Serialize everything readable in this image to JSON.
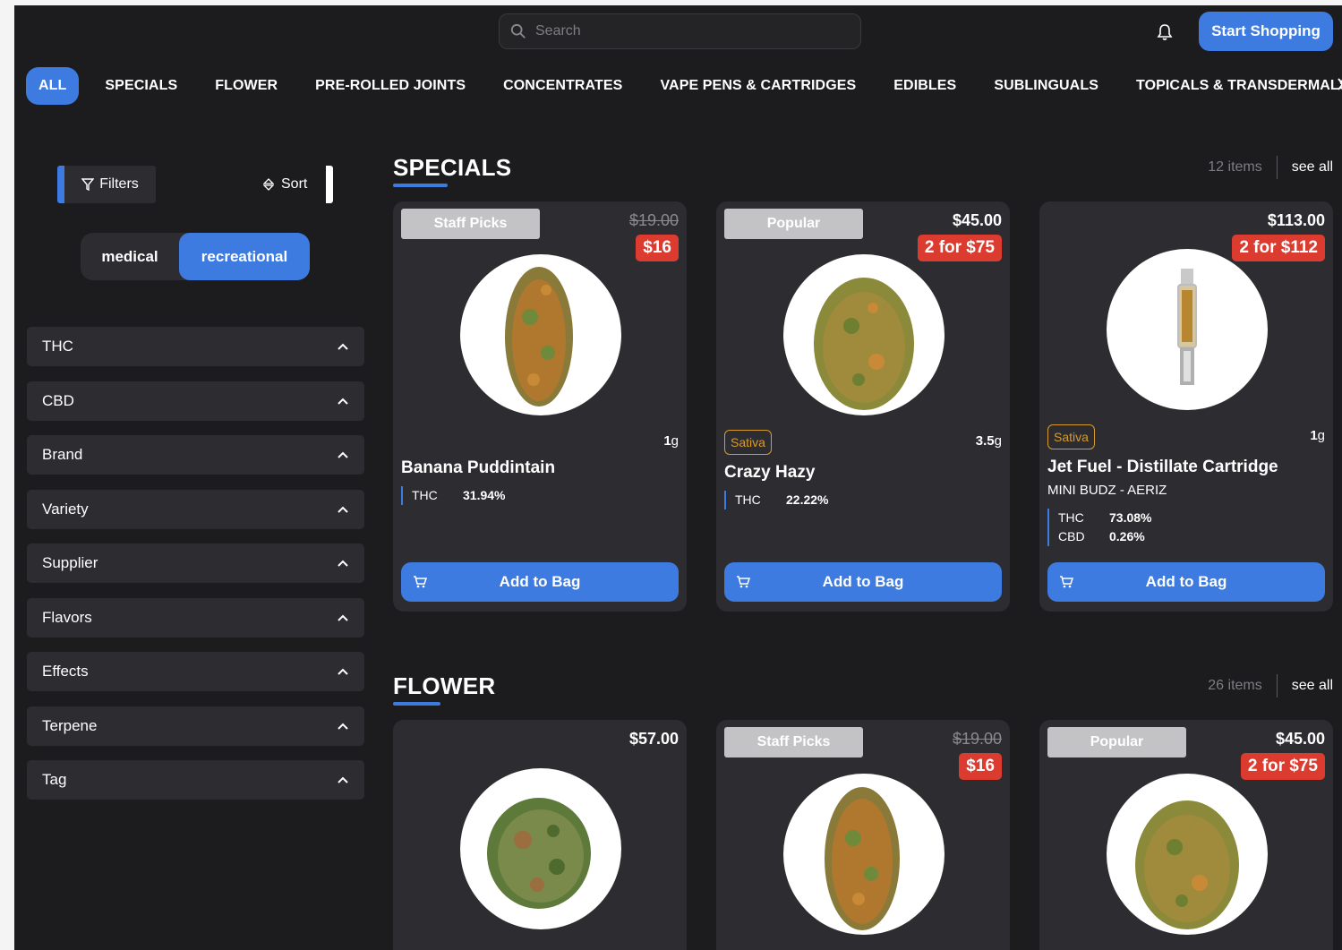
{
  "header": {
    "search_placeholder": "Search",
    "start_shopping_label": "Start Shopping"
  },
  "nav": {
    "items": [
      {
        "label": "ALL",
        "active": true
      },
      {
        "label": "SPECIALS"
      },
      {
        "label": "FLOWER"
      },
      {
        "label": "PRE-ROLLED JOINTS"
      },
      {
        "label": "CONCENTRATES"
      },
      {
        "label": "VAPE PENS & CARTRIDGES"
      },
      {
        "label": "EDIBLES"
      },
      {
        "label": "SUBLINGUALS"
      },
      {
        "label": "TOPICALS & TRANSDERMALS"
      }
    ]
  },
  "sidebar": {
    "filters_label": "Filters",
    "sort_label": "Sort",
    "toggle": {
      "medical": "medical",
      "recreational": "recreational",
      "selected": "recreational"
    },
    "accordion": [
      "THC",
      "CBD",
      "Brand",
      "Variety",
      "Supplier",
      "Flavors",
      "Effects",
      "Terpene",
      "Tag"
    ]
  },
  "sections": {
    "specials": {
      "title": "SPECIALS",
      "count": "12 items",
      "see_all": "see all",
      "cards": [
        {
          "badge": "Staff Picks",
          "price": "$19.00",
          "deal": "$16",
          "weight_num": "1",
          "weight_unit": "g",
          "name": "Banana Puddintain",
          "thc_label": "THC",
          "thc": "31.94%"
        },
        {
          "badge": "Popular",
          "price": "$45.00",
          "deal": "2 for $75",
          "strain": "Sativa",
          "weight_num": "3.5",
          "weight_unit": "g",
          "name": "Crazy Hazy",
          "thc_label": "THC",
          "thc": "22.22%"
        },
        {
          "price": "$113.00",
          "deal": "2 for $112",
          "strain": "Sativa",
          "weight_num": "1",
          "weight_unit": "g",
          "name": "Jet Fuel - Distillate Cartridge",
          "brand": "MINI BUDZ - AERIZ",
          "thc_label": "THC",
          "thc": "73.08%",
          "cbd_label": "CBD",
          "cbd": "0.26%"
        }
      ],
      "add_label": "Add to Bag"
    },
    "flower": {
      "title": "FLOWER",
      "count": "26 items",
      "see_all": "see all",
      "cards": [
        {
          "price": "$57.00"
        },
        {
          "badge": "Staff Picks",
          "price": "$19.00",
          "deal": "$16"
        },
        {
          "badge": "Popular",
          "price": "$45.00",
          "deal": "2 for $75"
        }
      ]
    }
  },
  "colors": {
    "accent": "#3d7be0",
    "deal": "#dc3c30",
    "sativa": "#d79a2b",
    "background": "#1c1c1e",
    "card": "#2d2d31"
  },
  "icons": [
    "search-icon",
    "bell-icon",
    "filter-icon",
    "sort-icon",
    "chevron-up-icon",
    "cart-icon",
    "chevron-right-icon"
  ]
}
